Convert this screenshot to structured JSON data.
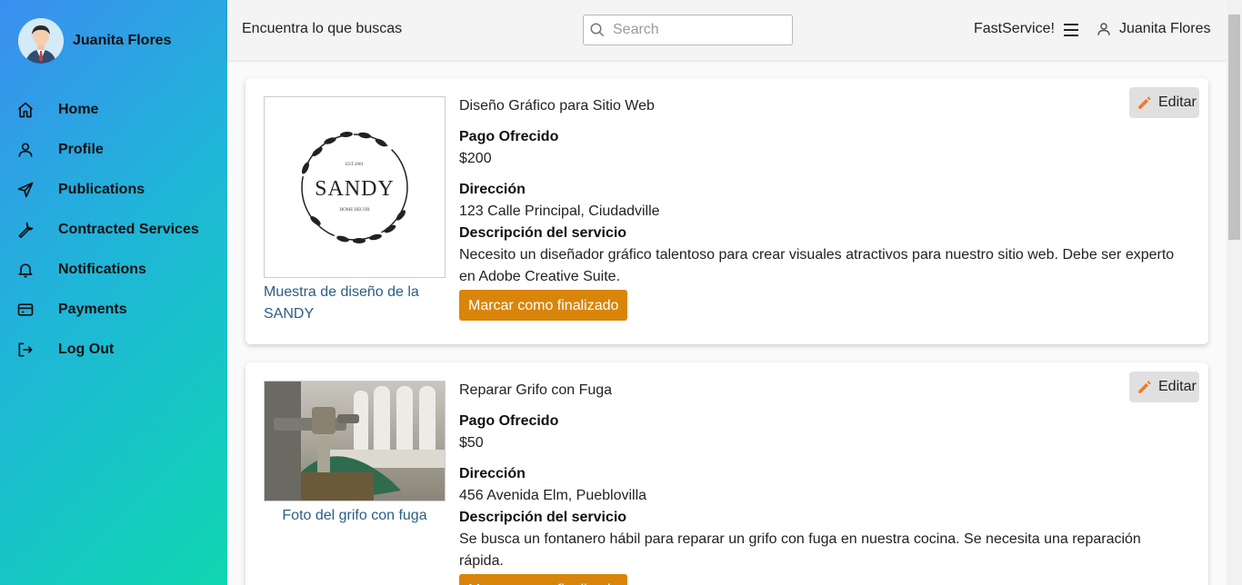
{
  "sidebar": {
    "user_name": "Juanita Flores",
    "items": [
      {
        "label": "Home",
        "icon": "home-icon"
      },
      {
        "label": "Profile",
        "icon": "user-icon"
      },
      {
        "label": "Publications",
        "icon": "send-icon"
      },
      {
        "label": "Contracted Services",
        "icon": "wrench-icon"
      },
      {
        "label": "Notifications",
        "icon": "bell-icon"
      },
      {
        "label": "Payments",
        "icon": "credit-card-icon"
      },
      {
        "label": "Log Out",
        "icon": "logout-icon"
      }
    ]
  },
  "topbar": {
    "tagline": "Encuentra lo que buscas",
    "search_placeholder": "Search",
    "brand": "FastService!",
    "user_name": "Juanita Flores"
  },
  "services": [
    {
      "title": "Diseño Gráfico para Sitio Web",
      "payment_label": "Pago Ofrecido",
      "payment": "$200",
      "address_label": "Dirección",
      "address": "123 Calle Principal, Ciudadville",
      "description_label": "Descripción del servicio",
      "description": "Necesito un diseñador gráfico talentoso para crear visuales atractivos para nuestro sitio web. Debe ser experto en Adobe Creative Suite.",
      "image_caption": "Muestra de diseño de la SANDY",
      "logo_text": "SANDY",
      "logo_est": "EST 2001",
      "logo_sub": "HOME DECOR",
      "finish_label": "Marcar como finalizado",
      "edit_label": "Editar"
    },
    {
      "title": "Reparar Grifo con Fuga",
      "payment_label": "Pago Ofrecido",
      "payment": "$50",
      "address_label": "Dirección",
      "address": "456 Avenida Elm, Pueblovilla",
      "description_label": "Descripción del servicio",
      "description": "Se busca un fontanero hábil para reparar un grifo con fuga en nuestra cocina. Se necesita una reparación rápida.",
      "image_caption": "Foto del grifo con fuga",
      "finish_label": "Marcar como finalizado",
      "edit_label": "Editar"
    }
  ],
  "colors": {
    "accent_button": "#d9850a",
    "caption_link": "#2a5d84",
    "edit_pencil": "#f07b2a"
  }
}
